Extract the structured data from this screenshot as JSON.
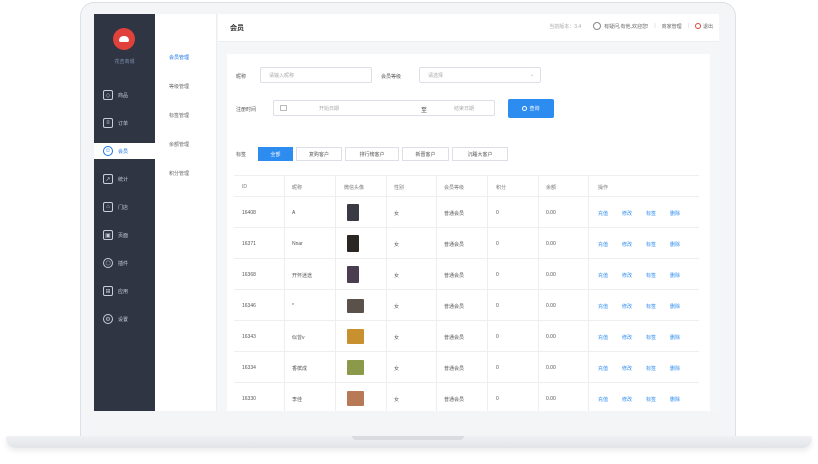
{
  "brand": {
    "shop_name": "花吉商城"
  },
  "sidebar": {
    "items": [
      {
        "label": "商品",
        "icon": "cube-icon"
      },
      {
        "label": "订单",
        "icon": "order-icon"
      },
      {
        "label": "会员",
        "icon": "member-icon",
        "active": true
      },
      {
        "label": "统计",
        "icon": "chart-icon"
      },
      {
        "label": "门店",
        "icon": "store-icon"
      },
      {
        "label": "页面",
        "icon": "page-icon"
      },
      {
        "label": "插件",
        "icon": "plugin-icon"
      },
      {
        "label": "应用",
        "icon": "apps-icon"
      },
      {
        "label": "设置",
        "icon": "gear-icon"
      }
    ]
  },
  "submenu": {
    "items": [
      {
        "label": "会员管理",
        "active": true
      },
      {
        "label": "等级管理"
      },
      {
        "label": "标签管理"
      },
      {
        "label": "余额管理"
      },
      {
        "label": "积分管理"
      }
    ]
  },
  "topbar": {
    "title": "会员",
    "version": "当前版本：3.4",
    "help": "有疑问,有他,欢迎您!",
    "account": "商家管理",
    "logout": "退出"
  },
  "filters": {
    "name_label": "昵称",
    "name_placeholder": "请输入昵称",
    "level_label": "会员等级",
    "level_placeholder": "请选择",
    "time_label": "注册时间",
    "start_placeholder": "开始日期",
    "date_separator": "至",
    "end_placeholder": "结束日期",
    "query_button": "查询",
    "tag_label": "标签",
    "tags": [
      "全部",
      "复购客户",
      "排行榜客户",
      "新晋客户",
      "沉睡大客户"
    ]
  },
  "table": {
    "columns": [
      "ID",
      "昵称",
      "微信头像",
      "性别",
      "会员等级",
      "积分",
      "余额",
      "操作"
    ],
    "actions": [
      "充值",
      "修改",
      "标签",
      "删除"
    ],
    "rows": [
      {
        "id": "16408",
        "nickname": "A",
        "gender": "女",
        "level": "普通会员",
        "points": "0",
        "balance": "0.00",
        "avatar_color": "#3a3a44"
      },
      {
        "id": "16371",
        "nickname": "Nnar",
        "gender": "女",
        "level": "普通会员",
        "points": "0",
        "balance": "0.00",
        "avatar_color": "#2a2624"
      },
      {
        "id": "16368",
        "nickname": "开怀迷途",
        "gender": "女",
        "level": "普通会员",
        "points": "0",
        "balance": "0.00",
        "avatar_color": "#4a3d4f"
      },
      {
        "id": "16346",
        "nickname": "*",
        "gender": "女",
        "level": "普通会员",
        "points": "0",
        "balance": "0.00",
        "avatar_color": "#5a524a"
      },
      {
        "id": "16343",
        "nickname": "似曾v",
        "gender": "女",
        "level": "普通会员",
        "points": "0",
        "balance": "0.00",
        "avatar_color": "#c8902e"
      },
      {
        "id": "16334",
        "nickname": "香槟成",
        "gender": "女",
        "level": "普通会员",
        "points": "0",
        "balance": "0.00",
        "avatar_color": "#8a9a4a"
      },
      {
        "id": "16330",
        "nickname": "李佳",
        "gender": "女",
        "level": "普通会员",
        "points": "0",
        "balance": "0.00",
        "avatar_color": "#b87a56"
      }
    ]
  }
}
